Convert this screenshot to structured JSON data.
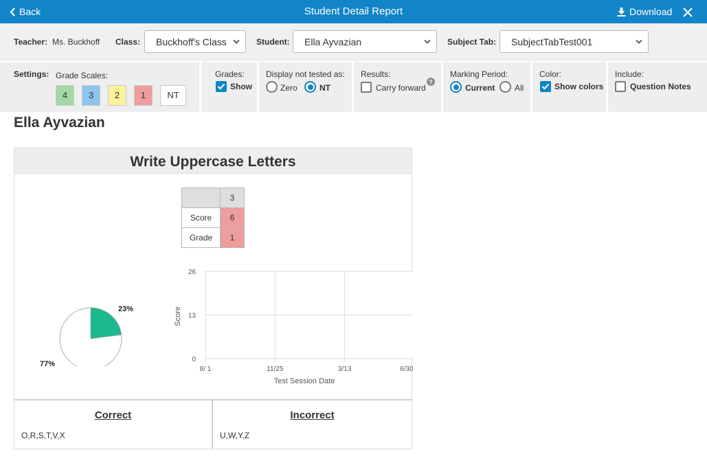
{
  "titlebar": {
    "back_label": "Back",
    "title": "Student Detail Report",
    "download_label": "Download"
  },
  "selectors": {
    "teacher_label": "Teacher:",
    "teacher_value": "Ms. Buckhoff",
    "class_label": "Class:",
    "class_value": "Buckhoff's Class",
    "student_label": "Student:",
    "student_value": "Ella Ayvazian",
    "subject_tab_label": "Subject Tab:",
    "subject_tab_value": "SubjectTabTest001"
  },
  "settings": {
    "settings_label": "Settings:",
    "grade_scales_label": "Grade Scales:",
    "grade_scales": [
      {
        "label": "4",
        "color": "#a6d8a6"
      },
      {
        "label": "3",
        "color": "#8cc6f0"
      },
      {
        "label": "2",
        "color": "#fbf29a"
      },
      {
        "label": "1",
        "color": "#ee9d9d"
      },
      {
        "label": "NT",
        "color": "#ffffff"
      }
    ],
    "grades_label": "Grades:",
    "grades_show": {
      "label": "Show",
      "checked": true
    },
    "display_not_tested_label": "Display not tested as:",
    "display_options": [
      {
        "label": "Zero",
        "selected": false
      },
      {
        "label": "NT",
        "selected": true
      }
    ],
    "results_label": "Results:",
    "carry_forward": {
      "label": "Carry forward",
      "checked": false
    },
    "marking_period_label": "Marking Period:",
    "marking_options": [
      {
        "label": "Current",
        "selected": true
      },
      {
        "label": "All",
        "selected": false
      }
    ],
    "color_label": "Color:",
    "show_colors": {
      "label": "Show colors",
      "checked": true
    },
    "include_label": "Include:",
    "question_notes": {
      "label": "Question Notes",
      "checked": false
    }
  },
  "report": {
    "student_name": "Ella Ayvazian",
    "card_title": "Write Uppercase Letters",
    "score_table": {
      "column": "3",
      "rows": [
        {
          "label": "Score",
          "value": "6",
          "color": "#ee9d9d"
        },
        {
          "label": "Grade",
          "value": "1",
          "color": "#ee9d9d"
        }
      ]
    },
    "correct_title": "Correct",
    "correct_values": "O,R,S,T,V,X",
    "incorrect_title": "Incorrect",
    "incorrect_values": "U,W,Y,Z"
  },
  "chart_data": [
    {
      "type": "pie",
      "slices": [
        {
          "label": "23%",
          "value": 23,
          "color": "#1bb98e"
        },
        {
          "label": "77%",
          "value": 77,
          "color": "#ffffff"
        }
      ]
    },
    {
      "type": "line",
      "xlabel": "Test Session Date",
      "ylabel": "Score",
      "x_ticks": [
        "8/ 1",
        "11/25",
        "3/13",
        "6/30"
      ],
      "y_ticks": [
        "0",
        "13",
        "26"
      ],
      "ylim": [
        0,
        26
      ],
      "grid": true,
      "series": []
    }
  ]
}
